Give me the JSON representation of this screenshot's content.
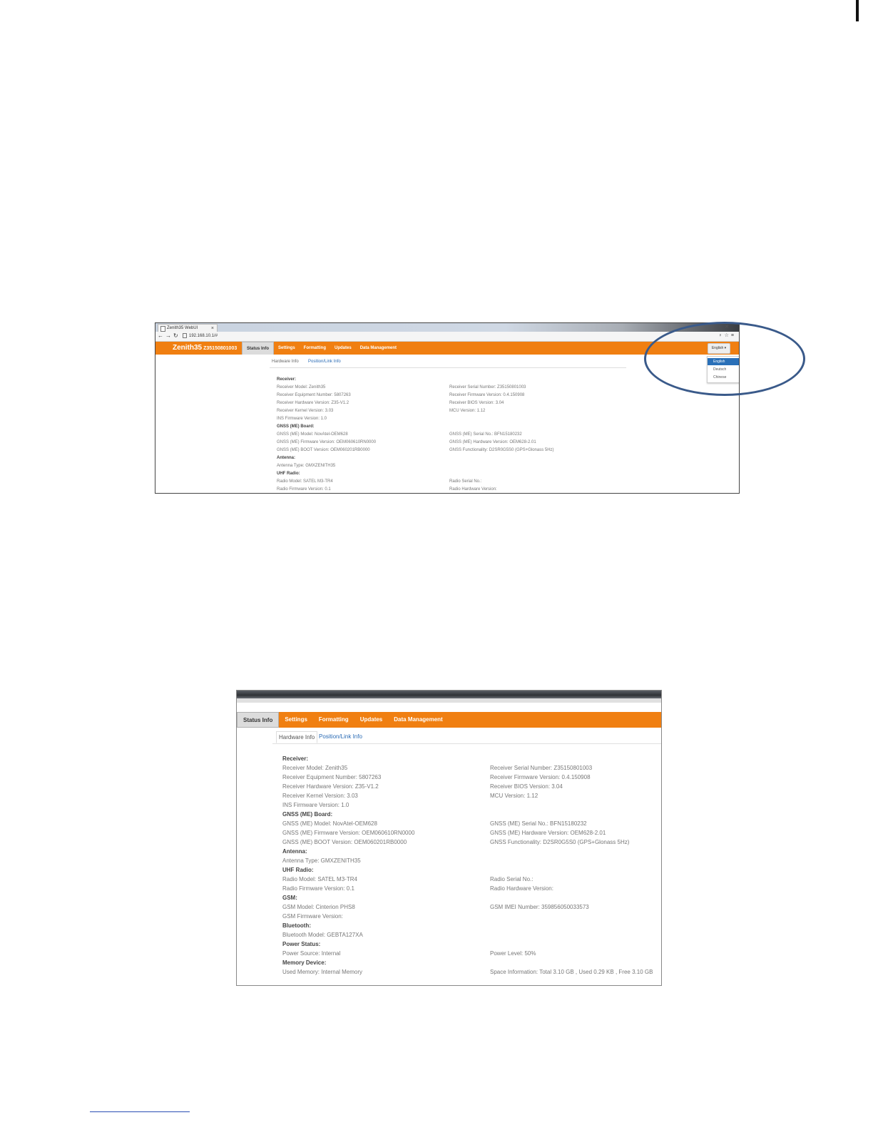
{
  "browser": {
    "tab_title": "Zenith35 WebUI",
    "tab_close": "×",
    "url": "192.168.10.1/#"
  },
  "header": {
    "brand": "Zenith35",
    "serial": "Z35150801003",
    "menu": [
      "Status Info",
      "Settings",
      "Formatting",
      "Updates",
      "Data Management"
    ],
    "language_button": "English ▾",
    "language_options": [
      "English",
      "Deutsch",
      "Chinese"
    ]
  },
  "subtabs": [
    "Hardware Info",
    "Position/Link Info"
  ],
  "screenshot1_rows": [
    {
      "l": "Receiver:",
      "lh": true,
      "r": ""
    },
    {
      "l": "Receiver Model:  Zenith35",
      "r": "Receiver Serial Number:  Z35150801003"
    },
    {
      "l": "Receiver Equipment Number:  5807263",
      "r": "Receiver Firmware Version:  0.4.150908"
    },
    {
      "l": "Receiver Hardware Version:  Z35-V1.2",
      "r": "Receiver BIOS Version:  3.04"
    },
    {
      "l": "Receiver Kernel Version:  3.03",
      "r": "MCU Version:  1.12"
    },
    {
      "l": "INS Firmware Version:  1.0",
      "r": ""
    },
    {
      "l": "GNSS (ME) Board:",
      "lh": true,
      "r": ""
    },
    {
      "l": "GNSS (ME) Model:  NovAtel-OEM628",
      "r": "GNSS (ME) Serial No.:  BFN15180232"
    },
    {
      "l": "GNSS (ME) Firmware Version:  OEM060610RN0000",
      "r": "GNSS (ME) Hardware Version:  OEM628-2.01"
    },
    {
      "l": "GNSS (ME) BOOT Version:  OEM060201RB0000",
      "r": "GNSS Functionality:  D2SR0G5S0 (GPS+Glonass 5Hz)"
    },
    {
      "l": "Antenna:",
      "lh": true,
      "r": ""
    },
    {
      "l": "Antenna Type:  GMXZENITH35",
      "r": ""
    },
    {
      "l": "UHF Radio:",
      "lh": true,
      "r": ""
    },
    {
      "l": "Radio Model:  SATEL M3-TR4",
      "r": "Radio Serial No.:"
    },
    {
      "l": "Radio Firmware Version:  0.1",
      "r": "Radio Hardware Version:"
    }
  ],
  "screenshot2_rows": [
    {
      "l": "Receiver:",
      "lh": true,
      "r": ""
    },
    {
      "l": "Receiver Model:  Zenith35",
      "r": "Receiver Serial Number:  Z35150801003"
    },
    {
      "l": "Receiver Equipment Number:  5807263",
      "r": "Receiver Firmware Version:  0.4.150908"
    },
    {
      "l": "Receiver Hardware Version:  Z35-V1.2",
      "r": "Receiver BIOS Version:  3.04"
    },
    {
      "l": "Receiver Kernel Version:  3.03",
      "r": "MCU Version:  1.12"
    },
    {
      "l": "INS Firmware Version:  1.0",
      "r": ""
    },
    {
      "l": "GNSS (ME) Board:",
      "lh": true,
      "r": ""
    },
    {
      "l": "GNSS (ME) Model:  NovAtel-OEM628",
      "r": "GNSS (ME) Serial No.:  BFN15180232"
    },
    {
      "l": "GNSS (ME) Firmware Version:  OEM060610RN0000",
      "r": "GNSS (ME) Hardware Version:  OEM628-2.01"
    },
    {
      "l": "GNSS (ME) BOOT Version:  OEM060201RB0000",
      "r": "GNSS Functionality:  D2SR0G5S0 (GPS+Glonass 5Hz)"
    },
    {
      "l": "Antenna:",
      "lh": true,
      "r": ""
    },
    {
      "l": "Antenna Type:  GMXZENITH35",
      "r": ""
    },
    {
      "l": "UHF Radio:",
      "lh": true,
      "r": ""
    },
    {
      "l": "Radio Model:  SATEL M3-TR4",
      "r": "Radio Serial No.:"
    },
    {
      "l": "Radio Firmware Version:  0.1",
      "r": "Radio Hardware Version:"
    },
    {
      "l": "GSM:",
      "lh": true,
      "r": ""
    },
    {
      "l": "GSM Model:  Cinterion PHS8",
      "r": "GSM IMEI Number:  359856050033573"
    },
    {
      "l": "GSM Firmware Version:",
      "r": ""
    },
    {
      "l": "Bluetooth:",
      "lh": true,
      "r": ""
    },
    {
      "l": "Bluetooth Model:  GEBTA127XA",
      "r": ""
    },
    {
      "l": "Power Status:",
      "lh": true,
      "r": ""
    },
    {
      "l": "Power Source:  Internal",
      "r": "Power Level:  50%"
    },
    {
      "l": "Memory Device:",
      "lh": true,
      "r": ""
    },
    {
      "l": "Used Memory:  Internal Memory",
      "r": "Space Information:  Total 3.10 GB , Used 0.29 KB , Free 3.10 GB"
    }
  ],
  "colors": {
    "orange": "#f07f11",
    "link_blue": "#2a6bb5",
    "ellipse": "#3a5a8a"
  }
}
